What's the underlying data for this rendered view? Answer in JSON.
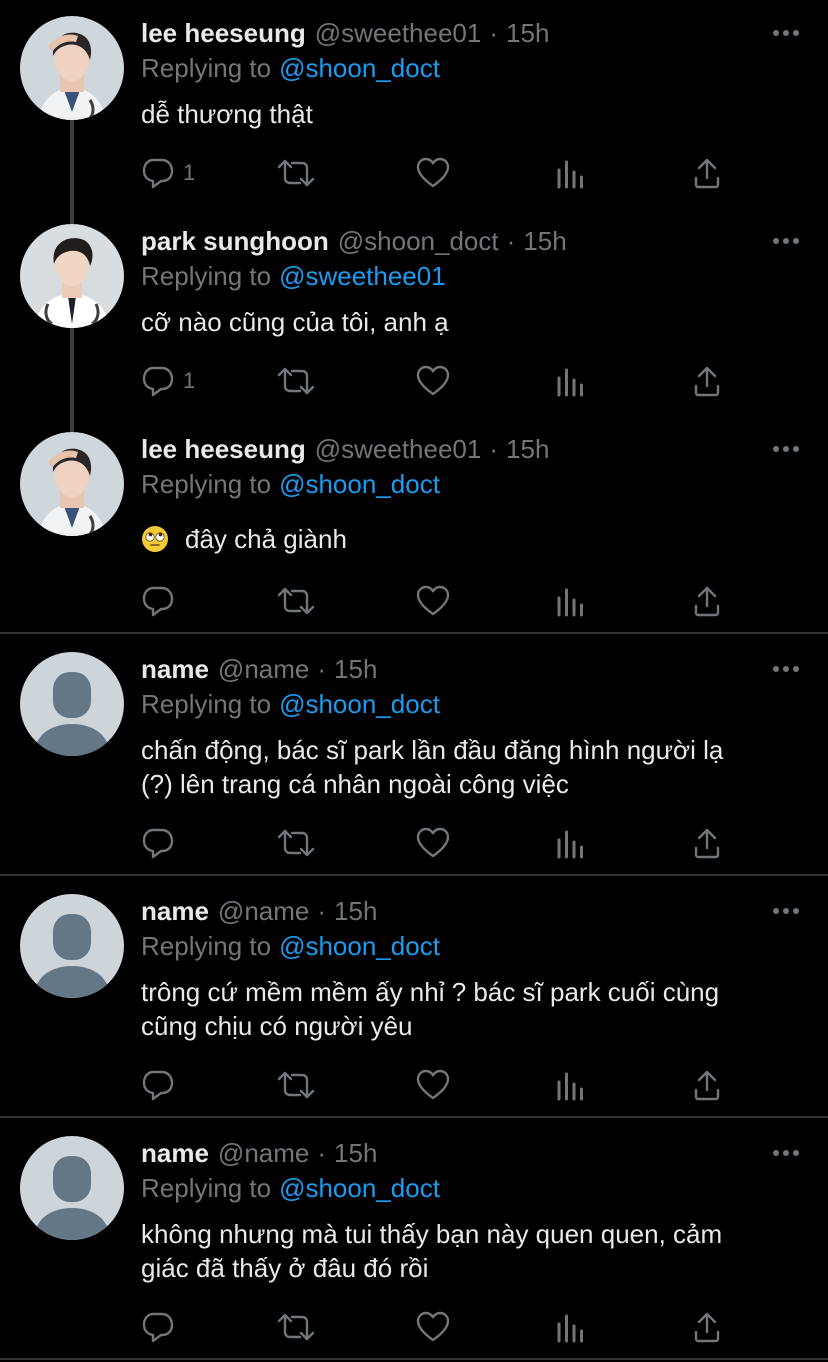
{
  "replying_label": "Replying to",
  "tweets": [
    {
      "name": "lee heeseung",
      "handle": "@sweethee01",
      "dot": "·",
      "time": "15h",
      "reply_to": "@shoon_doct",
      "lines": [
        "dễ thương thật"
      ],
      "reply_count": "1",
      "avatar": "photo"
    },
    {
      "name": "park sunghoon",
      "handle": "@shoon_doct",
      "dot": "·",
      "time": "15h",
      "reply_to": "@sweethee01",
      "lines": [
        "cỡ nào cũng của tôi, anh ạ"
      ],
      "reply_count": "1",
      "avatar": "photo"
    },
    {
      "name": "lee heeseung",
      "handle": "@sweethee01",
      "dot": "·",
      "time": "15h",
      "reply_to": "@shoon_doct",
      "lines": [
        "đây chả giành"
      ],
      "emoji": "rolling-eyes-emoji",
      "reply_count": "",
      "avatar": "photo"
    },
    {
      "name": "name",
      "handle": "@name",
      "dot": "·",
      "time": "15h",
      "reply_to": "@shoon_doct",
      "lines": [
        "chấn động, bác sĩ park lần đầu đăng hình người lạ",
        "(?) lên trang cá nhân ngoài công việc"
      ],
      "reply_count": "",
      "avatar": "default"
    },
    {
      "name": "name",
      "handle": "@name",
      "dot": "·",
      "time": "15h",
      "reply_to": "@shoon_doct",
      "lines": [
        "trông cứ mềm mềm ấy nhỉ ? bác sĩ park cuối cùng",
        "cũng chịu có người yêu"
      ],
      "reply_count": "",
      "avatar": "default"
    },
    {
      "name": "name",
      "handle": "@name",
      "dot": "·",
      "time": "15h",
      "reply_to": "@shoon_doct",
      "lines": [
        "không nhưng mà tui thấy bạn này quen quen, cảm",
        "giác đã thấy ở đâu đó rồi"
      ],
      "reply_count": "",
      "avatar": "default"
    }
  ],
  "icons": {
    "reply": "reply-icon",
    "retweet": "retweet-icon",
    "like": "heart-icon",
    "views": "views-icon",
    "share": "share-icon",
    "more": "more-icon"
  },
  "colors": {
    "background": "#000000",
    "text": "#e7e9ea",
    "secondary": "#71767b",
    "accent": "#1d9bf0",
    "divider": "#2f3336"
  }
}
